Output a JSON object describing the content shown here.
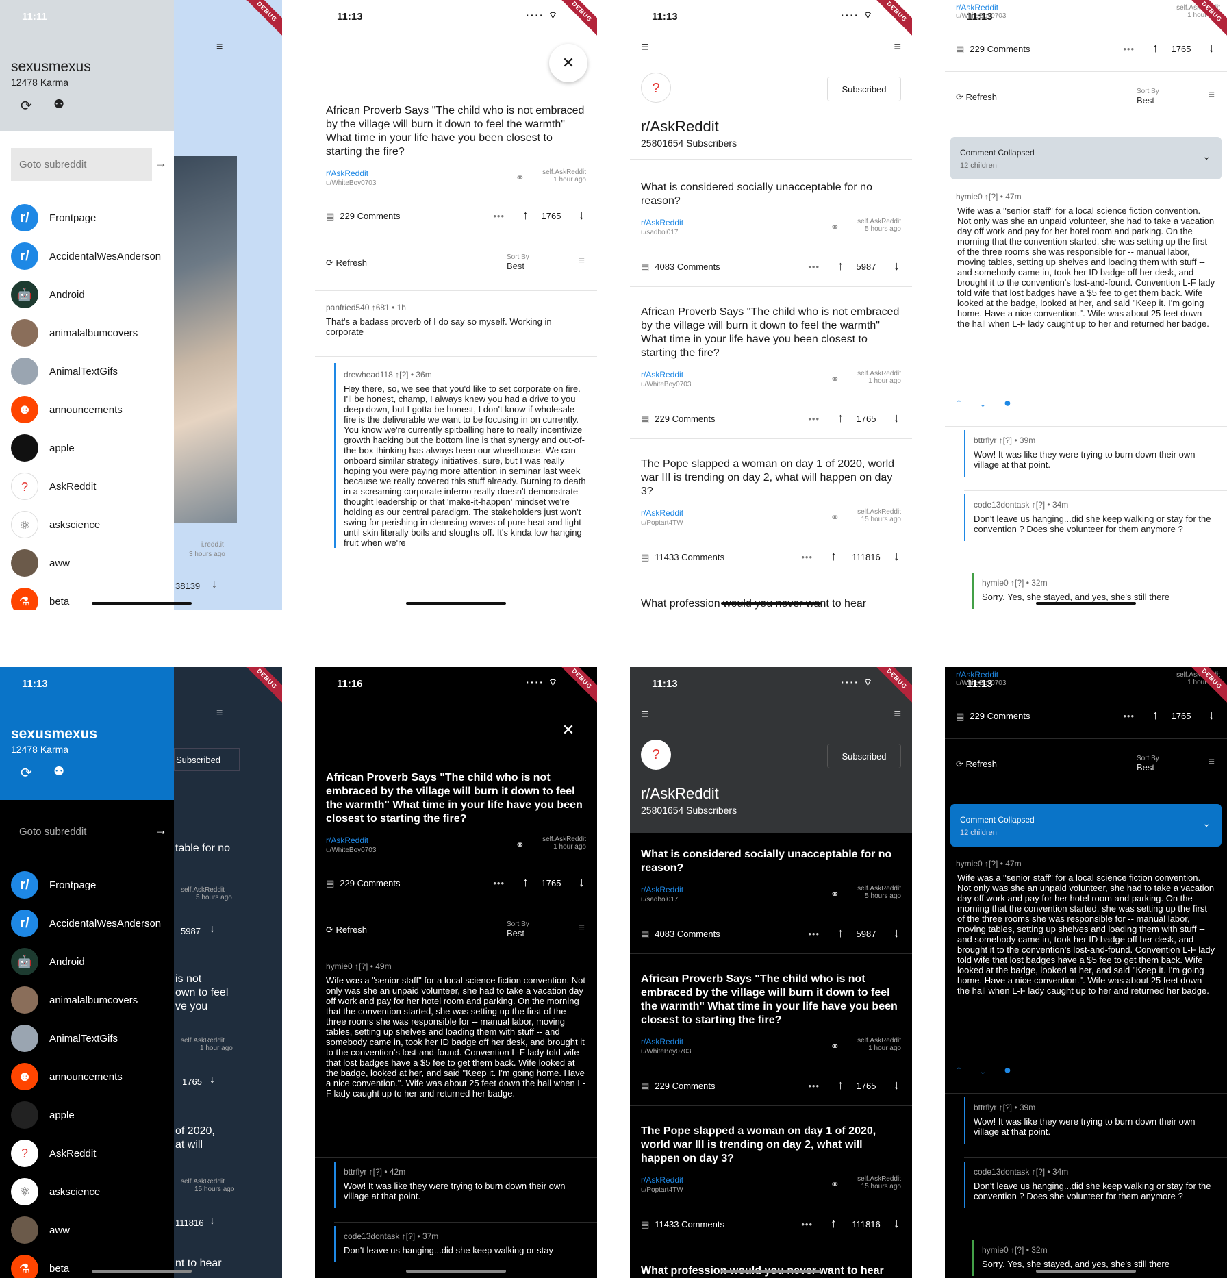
{
  "status": {
    "time_a": "11:11",
    "time_b": "11:13",
    "time_c": "11:16",
    "debug": "DEBUG"
  },
  "drawer": {
    "username": "sexusmexus",
    "karma": "12478 Karma",
    "goto_placeholder": "Goto subreddit",
    "subs": [
      "Frontpage",
      "AccidentalWesAnderson",
      "Android",
      "animalalbumcovers",
      "AnimalTextGifs",
      "announcements",
      "apple",
      "AskReddit",
      "askscience",
      "aww",
      "beta"
    ]
  },
  "behind": {
    "src": "i.redd.it",
    "time": "3 hours ago",
    "score": "38139",
    "subscribed": "Subscribed",
    "frag1": "table for no",
    "frag2": "is not",
    "frag3": "own to feel",
    "frag4": "ve you",
    "frag5": "of 2020,",
    "frag6": "at will",
    "frag7": "nt to hear",
    "s1": "5987",
    "s2": "1765",
    "s3": "111816",
    "t1": "5 hours ago",
    "t2": "1 hour ago",
    "t3": "15 hours ago",
    "selfsrc": "self.AskReddit"
  },
  "post": {
    "title": "African Proverb Says \"The child who is not embraced by the village will burn it down to feel the warmth\" What time in your life have you been closest to starting the fire?",
    "sub": "r/AskReddit",
    "author": "u/WhiteBoy0703",
    "src": "self.AskReddit",
    "time": "1 hour ago",
    "comments": "229 Comments",
    "score": "1765"
  },
  "refresh": {
    "label": "Refresh",
    "sort_by": "Sort By",
    "sort_value": "Best"
  },
  "c_a": {
    "head": "panfried540 ↑681 • 1h",
    "body": "That's a badass proverb of I do say so myself. Working in corporate"
  },
  "c_b": {
    "head": "drewhead118 ↑[?] • 36m",
    "body": "Hey there, so, we see that you'd like to set corporate on fire. I'll be honest, champ, I always knew you had a drive to you deep down, but I gotta be honest, I don't know if wholesale fire is the deliverable we want to be focusing in on currently. You know we're currently spitballing here to really incentivize growth hacking but the bottom line is that synergy and out-of-the-box thinking has always been our wheelhouse. We can onboard similar strategy initiatives, sure, but I was really hoping you were paying more attention in seminar last week because we really covered this stuff already. Burning to death in a screaming corporate inferno really doesn't demonstrate thought leadership or that 'make-it-happen' mindset we're holding as our central paradigm. The stakeholders just won't swing for perishing in cleansing waves of pure heat and light until skin literally boils and sloughs off. It's kinda low hanging fruit when we're"
  },
  "sub_page": {
    "name": "r/AskReddit",
    "subscribers": "25801654 Subscribers",
    "subscribed": "Subscribed"
  },
  "feed": [
    {
      "title": "What is considered socially unacceptable for no reason?",
      "sub": "r/AskReddit",
      "author": "u/sadboi017",
      "src": "self.AskReddit",
      "time": "5 hours ago",
      "comments": "4083 Comments",
      "score": "5987"
    },
    {
      "title": "African Proverb Says \"The child who is not embraced by the village will burn it down to feel the warmth\" What time in your life have you been closest to starting the fire?",
      "sub": "r/AskReddit",
      "author": "u/WhiteBoy0703",
      "src": "self.AskReddit",
      "time": "1 hour ago",
      "comments": "229 Comments",
      "score": "1765"
    },
    {
      "title": "The Pope slapped a woman on day 1 of 2020, world war III is trending on day 2, what will happen on day 3?",
      "sub": "r/AskReddit",
      "author": "u/Poptart4TW",
      "src": "self.AskReddit",
      "time": "15 hours ago",
      "comments": "11433 Comments",
      "score": "111816"
    },
    {
      "title": "What profession would you never want to hear"
    }
  ],
  "collapsed": {
    "label": "Comment Collapsed",
    "children": "12 children"
  },
  "c_h47": {
    "head": "hymie0 ↑[?] • 47m",
    "head49": "hymie0 ↑[?] • 49m",
    "body": "Wife was a \"senior staff\" for a local science fiction convention. Not only was she an unpaid volunteer, she had to take a vacation day off work and pay for her hotel room and parking. On the morning that the convention started, she was setting up the first of the three rooms she was responsible for -- manual labor, moving tables, setting up shelves and loading them with stuff -- and somebody came in, took her ID badge off her desk, and brought it to the convention's lost-and-found. Convention L-F lady told wife that lost badges have a $5 fee to get them back. Wife looked at the badge, looked at her, and said \"Keep it. I'm going home. Have a nice convention.\". Wife was about 25 feet down the hall when L-F lady caught up to her and returned her badge."
  },
  "c_btt": {
    "head": "bttrflyr ↑[?] • 39m",
    "head42": "bttrflyr ↑[?] • 42m",
    "body": "Wow! It was like they were trying to burn down their own village at that point."
  },
  "c_code": {
    "head": "code13dontask ↑[?] • 34m",
    "head37": "code13dontask ↑[?] • 37m",
    "body": "Don't leave us hanging...did she keep walking or stay for the convention ? Does she volunteer for them anymore ?",
    "body_short": "Don't leave us hanging...did she keep walking or stay"
  },
  "c_hy32": {
    "head": "hymie0 ↑[?] • 32m",
    "body": "Sorry. Yes, she stayed, and yes, she's still there"
  },
  "colors": {
    "accent": "#1e88e5",
    "drawer_light": "#d6dbdf",
    "drawer_dark": "#0a74c8",
    "debug": "#b3243b"
  }
}
